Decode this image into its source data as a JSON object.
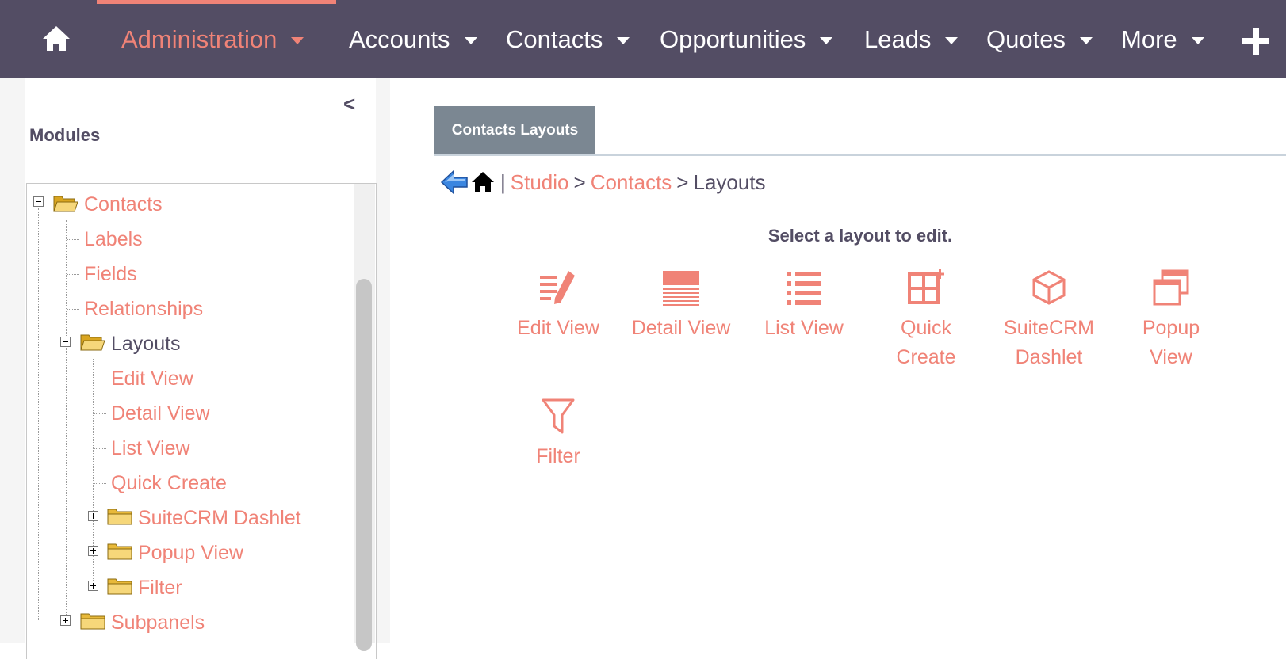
{
  "nav": {
    "items": [
      {
        "label": "Administration"
      },
      {
        "label": "Accounts"
      },
      {
        "label": "Contacts"
      },
      {
        "label": "Opportunities"
      },
      {
        "label": "Leads"
      },
      {
        "label": "Quotes"
      },
      {
        "label": "More"
      }
    ]
  },
  "sidebar": {
    "title": "Modules",
    "collapse_label": "<",
    "tree": [
      {
        "label": "Contacts"
      },
      {
        "label": "Labels"
      },
      {
        "label": "Fields"
      },
      {
        "label": "Relationships"
      },
      {
        "label": "Layouts"
      },
      {
        "label": "Edit View"
      },
      {
        "label": "Detail View"
      },
      {
        "label": "List View"
      },
      {
        "label": "Quick Create"
      },
      {
        "label": "SuiteCRM Dashlet"
      },
      {
        "label": "Popup View"
      },
      {
        "label": "Filter"
      },
      {
        "label": "Subpanels"
      }
    ]
  },
  "main": {
    "tab_label": "Contacts Layouts",
    "breadcrumb": {
      "sep1": "|",
      "studio": "Studio",
      "gt1": ">",
      "contacts": "Contacts",
      "gt2": ">",
      "current": "Layouts"
    },
    "hint": "Select a layout to edit.",
    "layouts": [
      {
        "line1": "Edit View",
        "line2": ""
      },
      {
        "line1": "Detail View",
        "line2": ""
      },
      {
        "line1": "List View",
        "line2": ""
      },
      {
        "line1": "Quick",
        "line2": "Create"
      },
      {
        "line1": "SuiteCRM",
        "line2": "Dashlet"
      },
      {
        "line1": "Popup",
        "line2": "View"
      },
      {
        "line1": "Filter",
        "line2": ""
      }
    ]
  },
  "colors": {
    "nav_bg": "#534d64",
    "accent": "#f08377",
    "tab_bg": "#7b8792",
    "text_dark": "#534d64"
  }
}
